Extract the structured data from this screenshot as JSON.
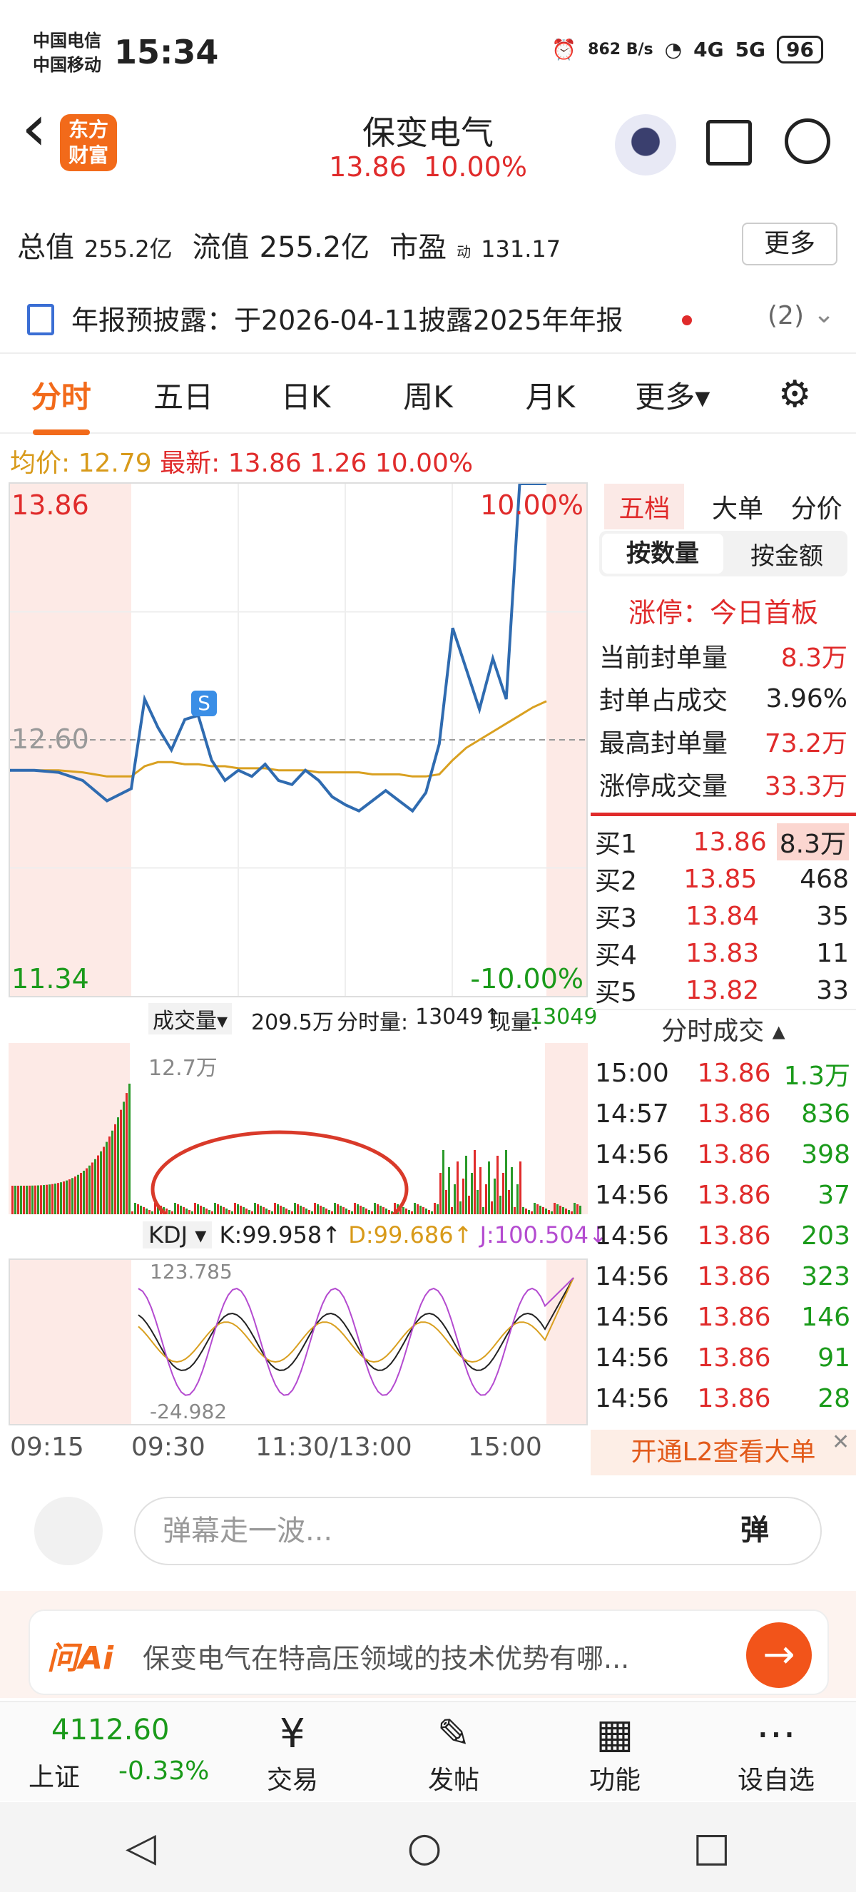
{
  "status": {
    "carrier1": "中国电信",
    "carrier2": "中国移动",
    "time": "15:34",
    "net_speed": "862 B/s",
    "net1": "4G",
    "net2": "5G",
    "battery": "96"
  },
  "header": {
    "back": "‹",
    "logo": "东方财富",
    "name": "保变电气",
    "price": "13.86",
    "pct": "10.00%"
  },
  "stats": {
    "zz_label": "总值",
    "zz_value": "255.2亿",
    "lz_label": "流值",
    "lz_value": "255.2亿",
    "sy_label": "市盈",
    "sy_sup": "动",
    "sy_value": "131.17",
    "more": "更多"
  },
  "notice": {
    "text": "年报预披露：于2026-04-11披露2025年年报",
    "count": "(2)"
  },
  "tabs": [
    "分时",
    "五日",
    "日K",
    "周K",
    "月K",
    "更多▾"
  ],
  "info": {
    "avg_label": "均价:",
    "avg": "12.79",
    "last_label": "最新:",
    "last": "13.86",
    "chg": "1.26",
    "pct": "10.00%"
  },
  "chart_data": {
    "type": "line",
    "title": "",
    "xlabel": "",
    "ylabel": "",
    "ylim": [
      11.34,
      13.86
    ],
    "ref": 12.6,
    "y_top": "13.86",
    "y_mid": "12.60",
    "y_bottom": "11.34",
    "pct_top": "10.00%",
    "pct_bottom": "-10.00%",
    "x": [
      "09:15",
      "09:30",
      "11:30/13:00",
      "15:00"
    ],
    "series": [
      {
        "values": [
          12.45,
          12.45,
          12.44,
          12.4,
          12.3,
          12.36,
          12.8,
          12.66,
          12.55,
          12.7,
          12.72,
          12.5,
          12.4,
          12.45,
          12.42,
          12.48,
          12.4,
          12.38,
          12.45,
          12.4,
          12.32,
          12.28,
          12.25,
          12.3,
          12.35,
          12.3,
          12.25,
          12.34,
          12.58,
          13.15,
          12.95,
          12.75,
          13.0,
          12.8,
          13.86,
          13.86,
          13.86
        ]
      },
      {
        "values": [
          12.45,
          12.45,
          12.45,
          12.44,
          12.42,
          12.42,
          12.47,
          12.49,
          12.49,
          12.48,
          12.48,
          12.47,
          12.47,
          12.46,
          12.46,
          12.46,
          12.45,
          12.45,
          12.45,
          12.44,
          12.44,
          12.44,
          12.44,
          12.43,
          12.43,
          12.43,
          12.42,
          12.42,
          12.43,
          12.5,
          12.56,
          12.6,
          12.64,
          12.68,
          12.72,
          12.76,
          12.79
        ]
      }
    ]
  },
  "volume": {
    "label": "成交量▾",
    "total": "209.5万",
    "ts_label": "分时量:",
    "ts": "13049↑",
    "now_label": "现量:",
    "now": "13049",
    "max": "12.7万"
  },
  "kdj": {
    "label": "KDJ ▾",
    "k": "K:99.958↑",
    "d": "D:99.686↑",
    "j": "J:100.504↓",
    "max": "123.785",
    "min": "-24.982"
  },
  "side": {
    "tabs": [
      "五档",
      "大单",
      "分价"
    ],
    "subtabs": [
      "按数量",
      "按金额"
    ],
    "title": "涨停：今日首板",
    "rows": [
      [
        "当前封单量",
        "8.3万"
      ],
      [
        "封单占成交",
        "3.96%"
      ],
      [
        "最高封单量",
        "73.2万"
      ],
      [
        "涨停成交量",
        "33.3万"
      ]
    ],
    "book": [
      [
        "买1",
        "13.86",
        "8.3万"
      ],
      [
        "买2",
        "13.85",
        "468"
      ],
      [
        "买3",
        "13.84",
        "35"
      ],
      [
        "买4",
        "13.83",
        "11"
      ],
      [
        "买5",
        "13.82",
        "33"
      ]
    ],
    "trade_head": "分时成交 ▴",
    "trades": [
      [
        "15:00",
        "13.86",
        "1.3万"
      ],
      [
        "14:57",
        "13.86",
        "836"
      ],
      [
        "14:56",
        "13.86",
        "398"
      ],
      [
        "14:56",
        "13.86",
        "37"
      ],
      [
        "14:56",
        "13.86",
        "203"
      ],
      [
        "14:56",
        "13.86",
        "323"
      ],
      [
        "14:56",
        "13.86",
        "146"
      ],
      [
        "14:56",
        "13.86",
        "91"
      ],
      [
        "14:56",
        "13.86",
        "28"
      ]
    ],
    "l2": "开通L2查看大单"
  },
  "danmu": {
    "placeholder": "弹幕走一波...",
    "send": "弹"
  },
  "ai": {
    "logo": "问Ai",
    "text": "保变电气在特高压领域的技术优势有哪...",
    "go": "→"
  },
  "bottom": {
    "index_value": "4112.60",
    "index_name": "上证",
    "index_chg": "-0.33%",
    "trade": "交易",
    "post": "发帖",
    "func": "功能",
    "fav": "设自选"
  },
  "sysnav": {
    "back": "◁",
    "home": "○",
    "recent": "□"
  },
  "colors": {
    "accent": "#f26a1a",
    "up": "#e02b2b",
    "down": "#1a9a1a",
    "price_line": "#2f6bb0",
    "avg_line": "#d9a020"
  }
}
